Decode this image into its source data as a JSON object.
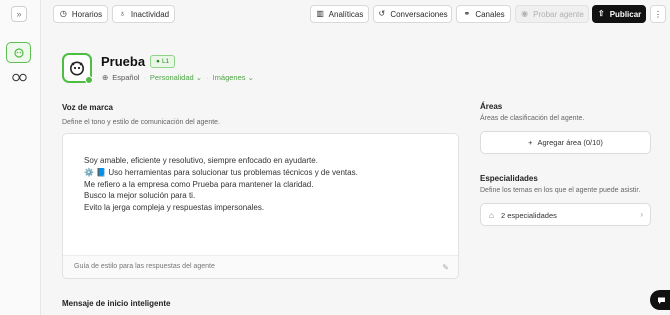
{
  "topbar": {
    "horarios": "Horarios",
    "inactividad": "Inactividad",
    "analiticas": "Analíticas",
    "conversaciones": "Conversaciones",
    "canales": "Canales",
    "probar_agente": "Probar agente",
    "publicar": "Publicar",
    "more": "⋮"
  },
  "agent": {
    "name": "Prueba",
    "version": "L1",
    "language": "Español",
    "personality": "Personalidad",
    "images": "Imágenes"
  },
  "brand_voice": {
    "title": "Voz de marca",
    "subtitle": "Define el tono y estilo de comunicación del agente.",
    "lines": [
      "Soy amable, eficiente y resolutivo, siempre enfocado en ayudarte.",
      "⚙️ 📘 Uso herramientas para solucionar tus problemas técnicos y de ventas.",
      "Me refiero a la empresa como Prueba para mantener la claridad.",
      "Busco la mejor solución para ti.",
      "Evito la jerga compleja y respuestas impersonales."
    ],
    "footer": "Guía de estilo para las respuestas del agente"
  },
  "areas": {
    "title": "Áreas",
    "subtitle": "Áreas de clasificación del agente.",
    "add_button": "Agregar área (0/10)"
  },
  "specialties": {
    "title": "Especialidades",
    "subtitle": "Define los temas en los que el agente puede asistir.",
    "count_label": "2 especialidades"
  },
  "smart_start": {
    "title": "Mensaje de inicio inteligente"
  },
  "colors": {
    "accent": "#4fbd43",
    "primary_button": "#111111"
  }
}
